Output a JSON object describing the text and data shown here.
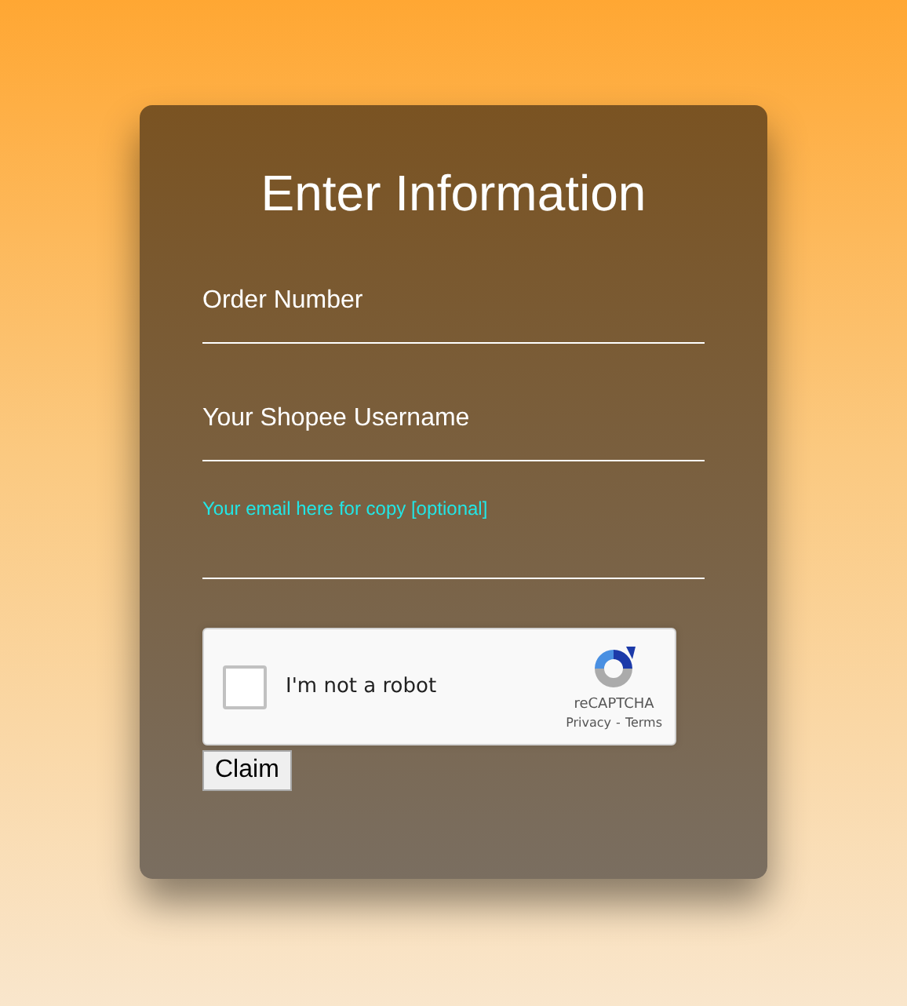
{
  "title": "Enter Information",
  "fields": [
    {
      "kind": "placeholder",
      "placeholder": "Order Number"
    },
    {
      "kind": "placeholder",
      "placeholder": "Your Shopee Username"
    },
    {
      "kind": "floating",
      "label": "Your email here for copy [optional]"
    }
  ],
  "captcha": {
    "label": "I'm not a robot",
    "checked": false,
    "brand": "reCAPTCHA",
    "privacy": "Privacy",
    "separator": "-",
    "terms": "Terms"
  },
  "button": "Claim"
}
